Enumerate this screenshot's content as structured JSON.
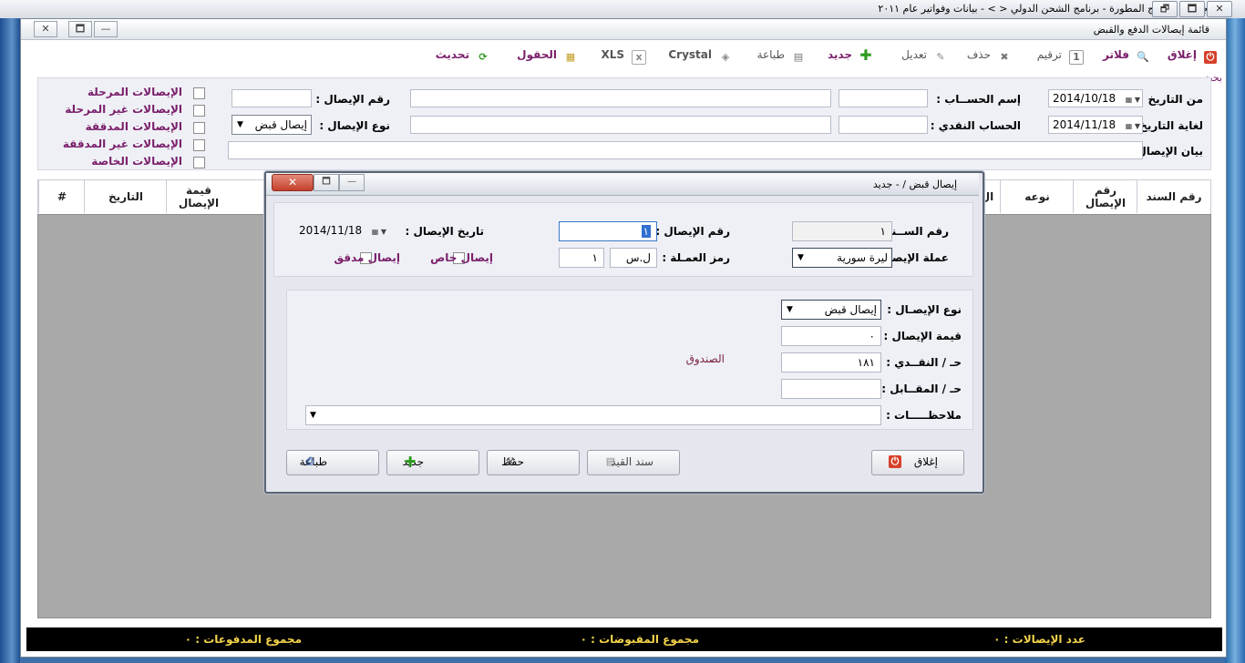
{
  "app": {
    "title": "مجموعة البرامج المطورة - برنامج الشحن الدولي < > - بيانات وفواتير عام ٢٠١١",
    "controls": [
      "🗗",
      "🗖",
      "✕"
    ]
  },
  "window": {
    "title": "قائمة إيصالات الدفع والقبض",
    "controls": [
      "✕",
      "🗖",
      "—"
    ]
  },
  "toolbar": {
    "close": "إغلاق",
    "filters": "فلاتر",
    "numbering": "ترقيم",
    "delete": "حذف",
    "edit": "تعديل",
    "new": "جديد",
    "print": "طباعة",
    "crystal": "Crystal",
    "xls": "XLS",
    "fields": "الحقول",
    "refresh": "تحديث"
  },
  "search": {
    "section_label": "بحث",
    "from_date_label": "من التاريخ :",
    "from_date_value": "2014/10/18",
    "to_date_label": "لغاية التاريخ :",
    "to_date_value": "2014/11/18",
    "account_name_label": "إسم الحســاب :",
    "cash_account_label": "الحساب النقدي :",
    "receipt_number_label": "رقم الإيصال :",
    "receipt_type_label": "نوع الإيصال :",
    "receipt_type_value": "إيصال قبض",
    "receipt_desc_label": "بيان الإيصال :",
    "checkboxes": [
      "الإيصالات المرحلة",
      "الإيصالات غير المرحلة",
      "الإيصالات المدققة",
      "الإيصالات غير المدققة",
      "الإيصالات الخاصة"
    ]
  },
  "grid": {
    "headers_right": [
      "رقم السند",
      "رقم الإيصال",
      "نوعه",
      "ال"
    ],
    "headers_left": [
      "قيمة الإيصال",
      "التاريخ",
      "#"
    ]
  },
  "status": {
    "receipts_count": "عدد الإيصالات : ٠",
    "received_total": "مجموع المقبوضات : ٠",
    "paid_total": "مجموع المدفوعات : ٠"
  },
  "dialog": {
    "title": "إيصال قبض / - جديد",
    "controls": [
      "✕",
      "🗖",
      "—"
    ],
    "voucher_number_label": "رقم الســند :",
    "voucher_number_value": "١",
    "receipt_number_label": "رقم الإيصال :",
    "receipt_number_value": "١",
    "receipt_date_label": "تاريخ الإيصال :",
    "receipt_date_value": "2014/11/18",
    "currency_label": "عملة الإيصال :",
    "currency_value": "ليرة سورية",
    "currency_code_label": "رمز العمـلة :",
    "currency_code_value": "ل.س",
    "currency_rate_value": "١",
    "special_receipt_label": "إيصال خاص",
    "audited_receipt_label": "إيصال مدقق",
    "type_label": "نوع الإيصـال :",
    "type_value": "إيصال قبض",
    "amount_label": "قيمة الإيصال :",
    "amount_value": "٠",
    "cash_account_label": "حـ / النقــدي :",
    "cash_account_value": "١٨١",
    "cash_account_name": "الصندوق",
    "counter_account_label": "حـ / المقــابل :",
    "notes_label": "ملاحظـــــات :",
    "buttons": {
      "close": "إغلاق",
      "journal": "سند القيد",
      "save": "حفظ",
      "new": "جديد",
      "print": "طباعة"
    }
  },
  "colors": {
    "label_purple": "#7b1f6b",
    "status_yellow": "#f3d34a",
    "grid_grey": "#a9a9a9",
    "close_red": "#d7412b",
    "add_green": "#2c9a1f"
  }
}
